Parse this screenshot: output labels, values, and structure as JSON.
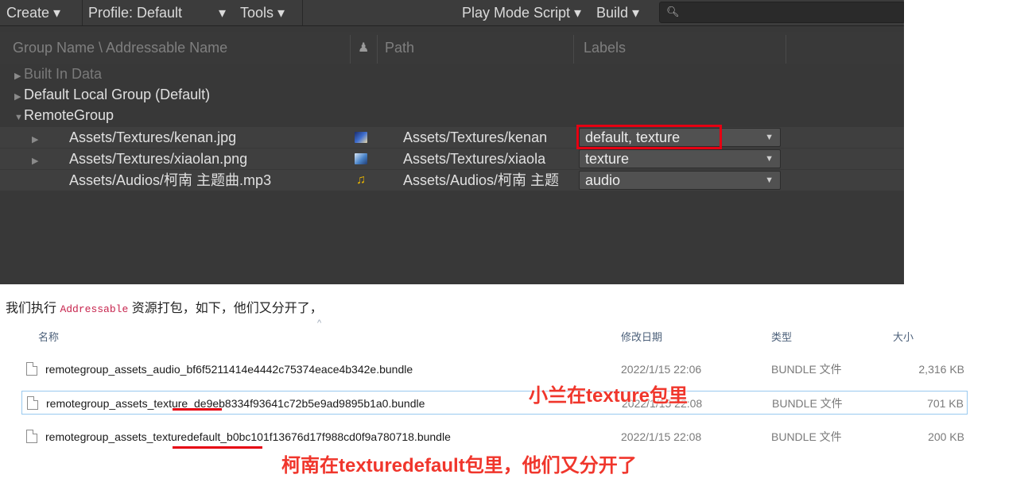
{
  "toolbar": {
    "create": "Create ▾",
    "profile": "Profile: Default",
    "profile_caret": "▾",
    "tools": "Tools ▾",
    "play_mode": "Play Mode Script ▾",
    "build": "Build ▾",
    "search_placeholder": ""
  },
  "header": {
    "group_name": "Group Name \\ Addressable Name",
    "path": "Path",
    "labels": "Labels"
  },
  "groups": [
    {
      "name": "Built In Data",
      "arrow": "▶"
    },
    {
      "name": "Default Local Group (Default)",
      "arrow": "▶"
    },
    {
      "name": "RemoteGroup",
      "arrow": "▼"
    }
  ],
  "entries": [
    {
      "name": "Assets/Textures/kenan.jpg",
      "path": "Assets/Textures/kenan",
      "labels": "default, texture",
      "arrow": "▶",
      "icon": "texture-thumb-icon"
    },
    {
      "name": "Assets/Textures/xiaolan.png",
      "path": "Assets/Textures/xiaola",
      "labels": "texture",
      "arrow": "▶",
      "icon": "texture-thumb-icon"
    },
    {
      "name": "Assets/Audios/柯南 主题曲.mp3",
      "path": "Assets/Audios/柯南 主题",
      "labels": "audio",
      "arrow": "",
      "icon": "audio-note-icon"
    }
  ],
  "caption": {
    "before": "我们执行 ",
    "code": "Addressable",
    "after": " 资源打包，如下，他们又分开了，"
  },
  "explorer": {
    "col_name": "名称",
    "col_date": "修改日期",
    "col_type": "类型",
    "col_size": "大小",
    "files": [
      {
        "name": "remotegroup_assets_audio_bf6f5211414e4442c75374eace4b342e.bundle",
        "date": "2022/1/15 22:06",
        "type": "BUNDLE 文件",
        "size": "2,316 KB"
      },
      {
        "name": "remotegroup_assets_texture_de9eb8334f93641c72b5e9ad9895b1a0.bundle",
        "date": "2022/1/15 22:08",
        "type": "BUNDLE 文件",
        "size": "701 KB"
      },
      {
        "name": "remotegroup_assets_texturedefault_b0bc101f13676d17f988cd0f9a780718.bundle",
        "date": "2022/1/15 22:08",
        "type": "BUNDLE 文件",
        "size": "200 KB"
      }
    ]
  },
  "annotations": {
    "note1": "小兰在texture包里",
    "note2": "柯南在texturedefault包里，他们又分开了",
    "color": "#f0362c"
  },
  "colors": {
    "panel_bg": "#383838",
    "highlight": "#e60012"
  }
}
